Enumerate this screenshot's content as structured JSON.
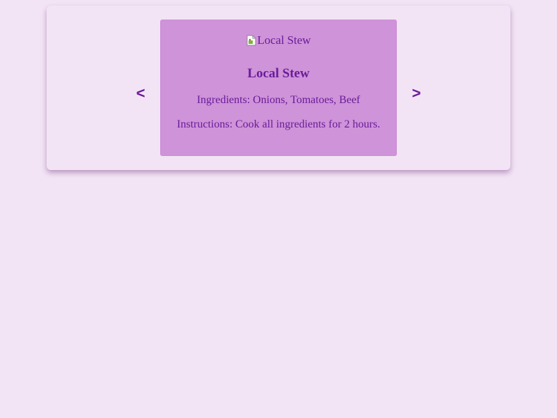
{
  "carousel": {
    "prev_label": "<",
    "next_label": ">",
    "slide": {
      "image_alt": "Local Stew",
      "title": "Local Stew",
      "ingredients": "Ingredients: Onions, Tomatoes, Beef",
      "instructions": "Instructions: Cook all ingredients for 2 hours."
    }
  },
  "colors": {
    "background": "#f3e4f5",
    "card": "#ce93d8",
    "text": "#6a1b9a"
  },
  "icons": {
    "image_placeholder": "broken-image-icon"
  }
}
